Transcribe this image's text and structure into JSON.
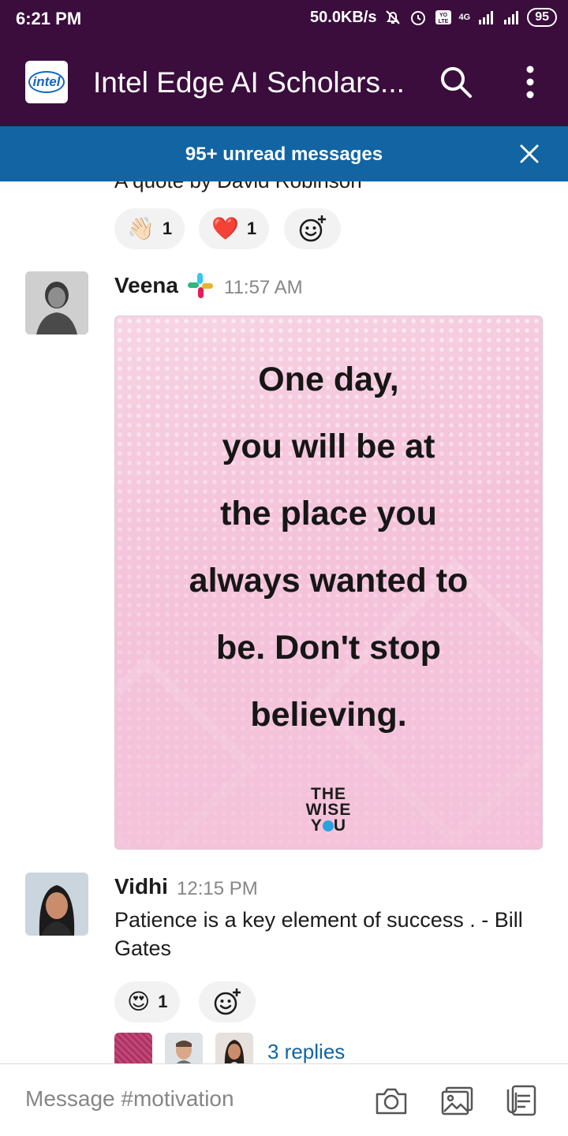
{
  "status_bar": {
    "time": "6:21 PM",
    "network_speed": "50.0KB/s",
    "network_type": "4G",
    "battery": "95"
  },
  "header": {
    "logo_text": "intel",
    "title": "Intel Edge AI Scholars...",
    "icons": [
      "search-icon",
      "more-vertical-icon"
    ]
  },
  "banner": {
    "text": "95+ unread messages",
    "icon": "close-icon"
  },
  "colors": {
    "header_bg": "#3a0d3c",
    "banner_bg": "#1264a3",
    "link": "#1264a3",
    "timestamp": "#868686"
  },
  "previous_message": {
    "text": "A quote by David Robinson",
    "reactions": [
      {
        "emoji": "👋🏻",
        "count": "1"
      },
      {
        "emoji": "❤️",
        "count": "1"
      }
    ]
  },
  "messages": [
    {
      "sender": "Veena",
      "time": "11:57 AM",
      "image": {
        "quote_lines": [
          "One day,",
          "you will be at",
          "the place you",
          "always wanted to",
          "be. Don't stop",
          "believing."
        ],
        "brand_lines": [
          "THE",
          "WISE",
          "Y",
          "U"
        ]
      }
    },
    {
      "sender": "Vidhi",
      "time": "12:15 PM",
      "text": "Patience is a key element of success . - Bill Gates",
      "reactions": [
        {
          "emoji": "😍",
          "count": "1"
        }
      ],
      "replies": "3 replies"
    }
  ],
  "composer": {
    "placeholder": "Message #motivation",
    "icons": [
      "camera-icon",
      "image-icon",
      "files-icon"
    ]
  }
}
